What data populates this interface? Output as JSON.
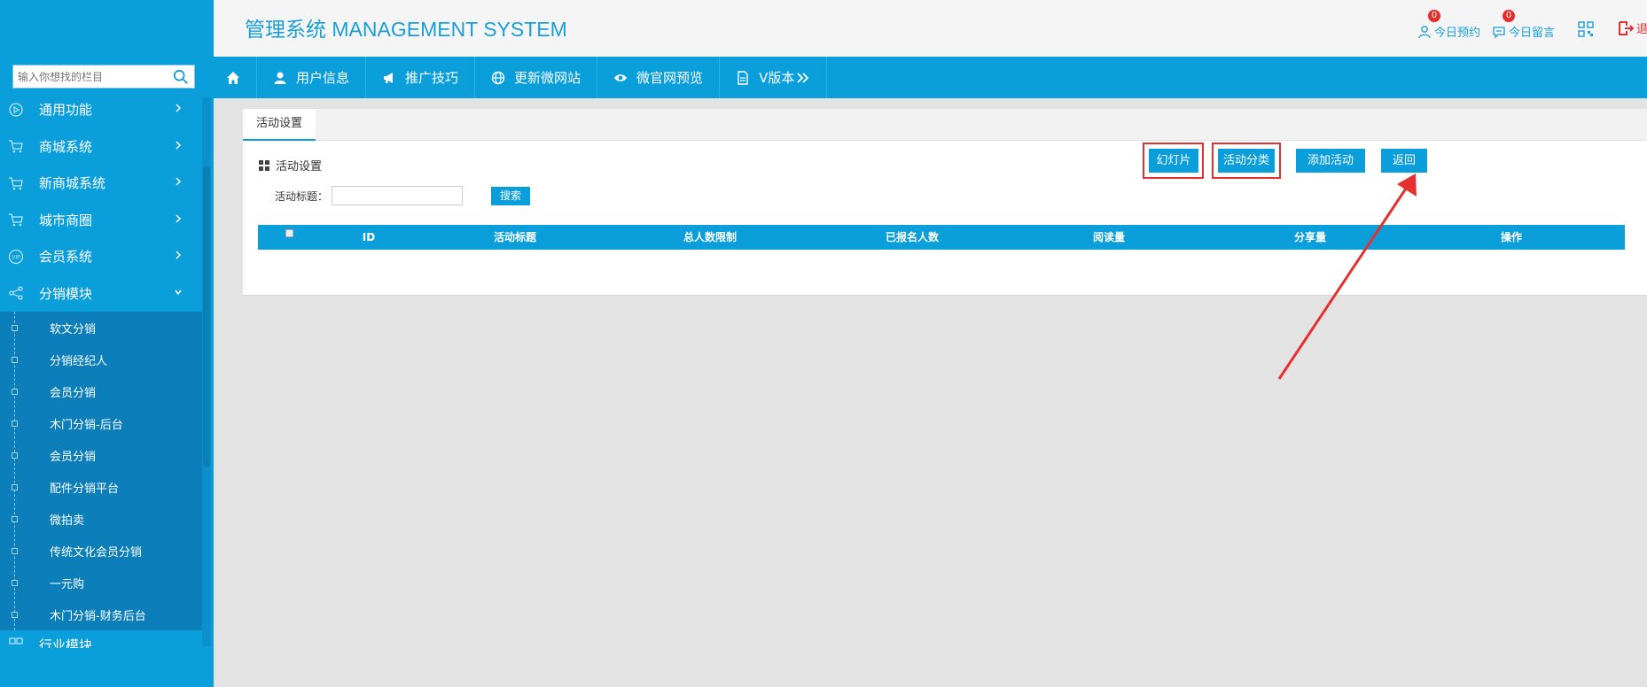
{
  "header": {
    "title": "管理系统 MANAGEMENT SYSTEM",
    "links": [
      {
        "label": "今日预约",
        "badge": "0",
        "icon": "user-icon"
      },
      {
        "label": "今日留言",
        "badge": "0",
        "icon": "chat-icon"
      }
    ],
    "qr_icon": "qr-code-icon",
    "logout_icon": "logout-icon",
    "logout_label_partial": "退"
  },
  "sidebar": {
    "search_placeholder": "输入你想找的栏目",
    "items": [
      {
        "label": "通用功能",
        "icon": "play-circle-icon"
      },
      {
        "label": "商城系统",
        "icon": "cart-icon"
      },
      {
        "label": "新商城系统",
        "icon": "cart-icon"
      },
      {
        "label": "城市商圈",
        "icon": "cart-icon"
      },
      {
        "label": "会员系统",
        "icon": "vip-icon"
      },
      {
        "label": "分销模块",
        "icon": "share-icon",
        "open": true
      }
    ],
    "subitems": [
      "软文分销",
      "分销经纪人",
      "会员分销",
      "木门分销-后台",
      "会员分销",
      "配件分销平台",
      "微拍卖",
      "传统文化会员分销",
      "一元购",
      "木门分销-财务后台"
    ],
    "partial_item": "行业模块"
  },
  "navbar": {
    "items": [
      {
        "label": "",
        "icon": "home-icon"
      },
      {
        "label": "用户信息",
        "icon": "user-icon"
      },
      {
        "label": "推广技巧",
        "icon": "megaphone-icon"
      },
      {
        "label": "更新微网站",
        "icon": "globe-icon"
      },
      {
        "label": "微官网预览",
        "icon": "eye-icon"
      },
      {
        "label": "V版本",
        "icon": "doc-icon"
      }
    ]
  },
  "content": {
    "tab": "活动设置",
    "panel_title": "活动设置",
    "search_label": "活动标题：",
    "search_button": "搜索",
    "buttons": [
      "幻灯片",
      "活动分类",
      "添加活动",
      "返回"
    ],
    "table_headers": [
      "ID",
      "活动标题",
      "总人数限制",
      "已报名人数",
      "阅读量",
      "分享量",
      "操作"
    ]
  },
  "colors": {
    "primary": "#0a9fdb",
    "highlight": "#e53030"
  }
}
